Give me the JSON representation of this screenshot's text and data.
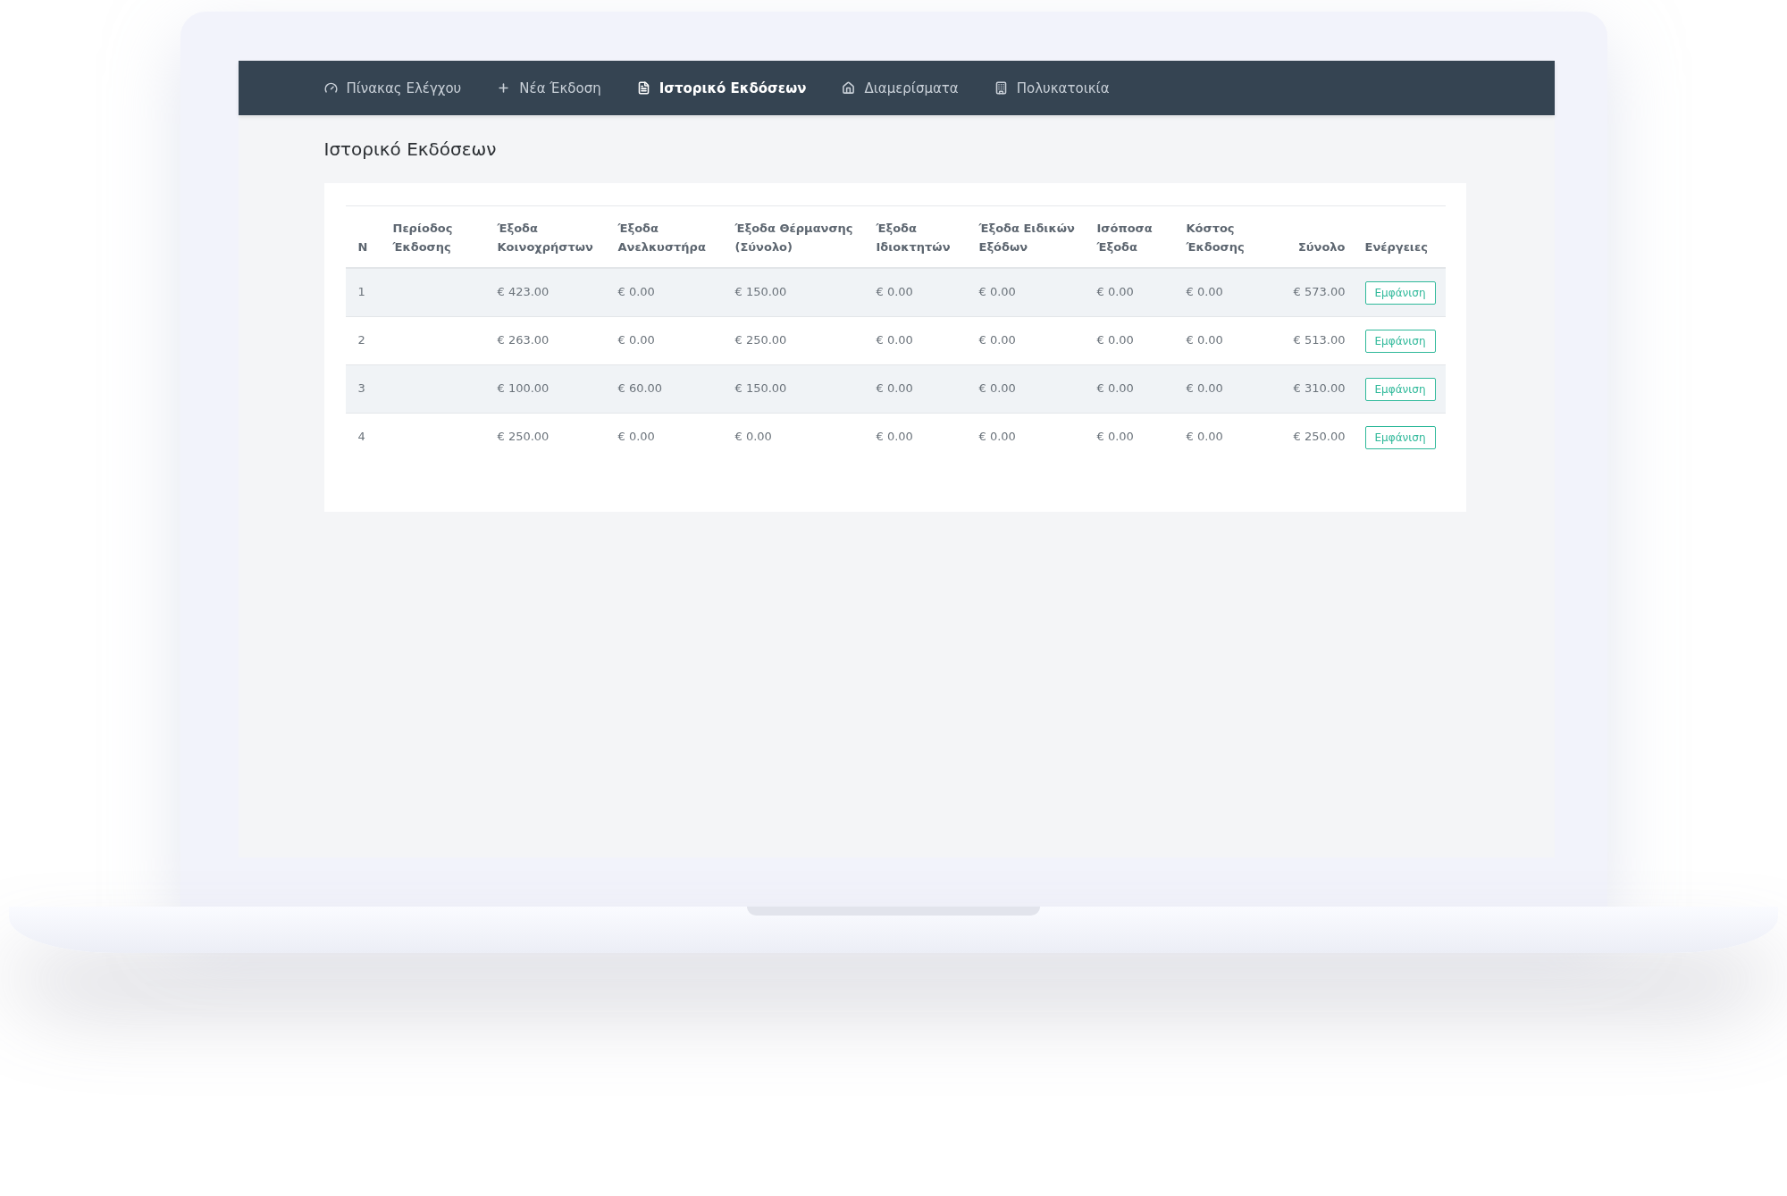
{
  "nav": [
    {
      "label": "Πίνακας Ελέγχου",
      "selected": false
    },
    {
      "label": "Νέα Έκδοση",
      "selected": false
    },
    {
      "label": "Ιστορικό Εκδόσεων",
      "selected": true
    },
    {
      "label": "Διαμερίσματα",
      "selected": false
    },
    {
      "label": "Πολυκατοικία",
      "selected": false
    }
  ],
  "page_title": "Ιστορικό Εκδόσεων",
  "table": {
    "columns": [
      "N",
      "Περίοδος Έκδοσης",
      "Έξοδα Κοινοχρήστων",
      "Έξοδα Ανελκυστήρα",
      "Έξοδα Θέρμανσης (Σύνολο)",
      "Έξοδα Ιδιοκτητών",
      "Έξοδα Ειδικών Εξόδων",
      "Ισόποσα Έξοδα",
      "Κόστος Έκδοσης",
      "Σύνολο",
      "Ενέργειες"
    ],
    "rows": [
      {
        "cells": [
          "1",
          "",
          "€ 423.00",
          "€ 0.00",
          "€ 150.00",
          "€ 0.00",
          "€ 0.00",
          "€ 0.00",
          "€ 0.00",
          "€ 573.00"
        ],
        "action": "Εμφάνιση"
      },
      {
        "cells": [
          "2",
          "",
          "€ 263.00",
          "€ 0.00",
          "€ 250.00",
          "€ 0.00",
          "€ 0.00",
          "€ 0.00",
          "€ 0.00",
          "€ 513.00"
        ],
        "action": "Εμφάνιση"
      },
      {
        "cells": [
          "3",
          "",
          "€ 100.00",
          "€ 60.00",
          "€ 150.00",
          "€ 0.00",
          "€ 0.00",
          "€ 0.00",
          "€ 0.00",
          "€ 310.00"
        ],
        "action": "Εμφάνιση"
      },
      {
        "cells": [
          "4",
          "",
          "€ 250.00",
          "€ 0.00",
          "€ 0.00",
          "€ 0.00",
          "€ 0.00",
          "€ 0.00",
          "€ 0.00",
          "€ 250.00"
        ],
        "action": "Εμφάνιση"
      }
    ]
  }
}
